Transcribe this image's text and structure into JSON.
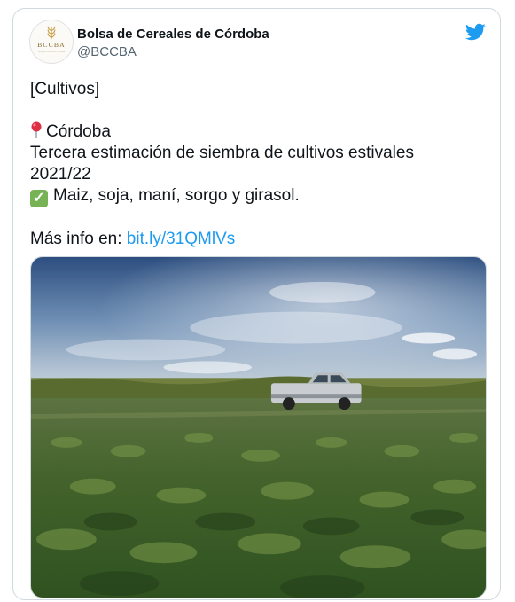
{
  "account": {
    "display_name": "Bolsa de Cereales de Córdoba",
    "handle": "@BCCBA",
    "avatar_text": "BCCBA",
    "avatar_subtext": "Bolsa de Cereales de Córdoba"
  },
  "tweet": {
    "line_1": "[Cultivos]",
    "line_2": "Córdoba",
    "line_3": "Tercera estimación de siembra de cultivos estivales",
    "line_4": "2021/22",
    "line_5": "Maiz, soja, maní, sorgo y girasol.",
    "more_info_label": "Más info en: ",
    "link_text": "bit.ly/31QMlVs"
  },
  "icons": {
    "brand": "twitter-bird-icon",
    "pin": "round-pushpin-icon",
    "check": "white-check-mark-icon"
  },
  "colors": {
    "accent": "#1d9bf0",
    "check_green": "#77b255",
    "pin_red": "#dd2e44"
  }
}
